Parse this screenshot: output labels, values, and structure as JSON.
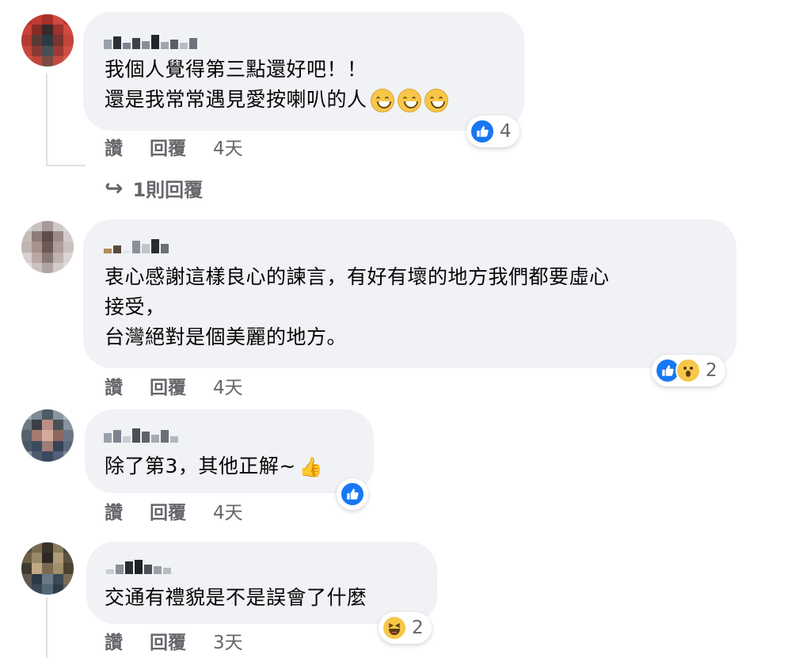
{
  "colors": {
    "bubble": "#f0f2f5",
    "meta_text": "#65676b",
    "like_blue": "#1877f2",
    "emoji_yellow": "#f7c74a"
  },
  "comments": [
    {
      "text": "我個人覺得第三點還好吧！！\n還是我常常遇見愛按喇叭的人",
      "emojis": [
        "grin-emoji",
        "grin-emoji",
        "grin-emoji"
      ],
      "reaction_icons": [
        "like-icon"
      ],
      "reaction_count": "4",
      "like_label": "讚",
      "reply_label": "回覆",
      "time": "4天",
      "replies_link": "1則回覆"
    },
    {
      "text": "衷心感謝這樣良心的諫言，有好有壞的地方我們都要虛心\n接受，\n台灣絕對是個美麗的地方。",
      "reaction_icons": [
        "like-icon",
        "wow-icon"
      ],
      "reaction_count": "2",
      "like_label": "讚",
      "reply_label": "回覆",
      "time": "4天"
    },
    {
      "text": "除了第3，其他正解~",
      "emojis": [
        "thumbs-up-emoji"
      ],
      "reaction_icons": [
        "like-icon"
      ],
      "like_label": "讚",
      "reply_label": "回覆",
      "time": "4天"
    },
    {
      "text": "交通有禮貌是不是誤會了什麼",
      "reaction_icons": [
        "haha-icon"
      ],
      "reaction_count": "2",
      "like_label": "讚",
      "reply_label": "回覆",
      "time": "3天"
    }
  ]
}
